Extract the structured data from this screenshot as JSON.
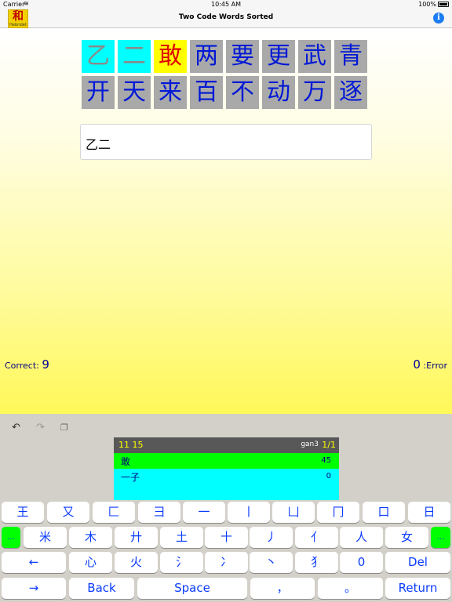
{
  "status_bar": {
    "carrier": "Carrier",
    "time": "10:45 AM",
    "battery": "100%"
  },
  "nav": {
    "logo_glyph": "和",
    "logo_sub": "Hebridet",
    "title": "Two Code Words Sorted",
    "info_icon": "i"
  },
  "tiles": [
    {
      "char": "乙",
      "style": "cyan"
    },
    {
      "char": "二",
      "style": "cyan"
    },
    {
      "char": "敢",
      "style": "yellow"
    },
    {
      "char": "两",
      "style": "gray"
    },
    {
      "char": "要",
      "style": "gray"
    },
    {
      "char": "更",
      "style": "gray"
    },
    {
      "char": "武",
      "style": "gray"
    },
    {
      "char": "青",
      "style": "gray"
    },
    {
      "char": "开",
      "style": "gray"
    },
    {
      "char": "天",
      "style": "gray"
    },
    {
      "char": "来",
      "style": "gray"
    },
    {
      "char": "百",
      "style": "gray"
    },
    {
      "char": "不",
      "style": "gray"
    },
    {
      "char": "动",
      "style": "gray"
    },
    {
      "char": "万",
      "style": "gray"
    },
    {
      "char": "逐",
      "style": "gray"
    }
  ],
  "text_area": {
    "value": "乙二"
  },
  "score": {
    "correct_label": "Correct:",
    "correct_value": "9",
    "error_value": "0",
    "error_label": ":Error"
  },
  "toolbar": {
    "undo": "undo-icon",
    "redo": "redo-icon",
    "copy": "copy-icon"
  },
  "candidates": {
    "code": "11 15",
    "pinyin": "gan3",
    "page": "1/1",
    "items": [
      {
        "word": "敢",
        "freq": "45"
      },
      {
        "word": "一子",
        "freq": "0"
      }
    ]
  },
  "keyboard": {
    "row1": [
      "王",
      "又",
      "匚",
      "彐",
      "一",
      "丨",
      "凵",
      "冂",
      "口",
      "日"
    ],
    "row2": [
      "...",
      "米",
      "木",
      "廾",
      "土",
      "十",
      "丿",
      "亻",
      "人",
      "女",
      "..."
    ],
    "row3": [
      "←",
      "心",
      "火",
      "氵",
      "冫",
      "丶",
      "犭",
      "0",
      "Del"
    ],
    "row4": [
      "→",
      "Back",
      "Space",
      "，",
      "。",
      "Return"
    ]
  }
}
